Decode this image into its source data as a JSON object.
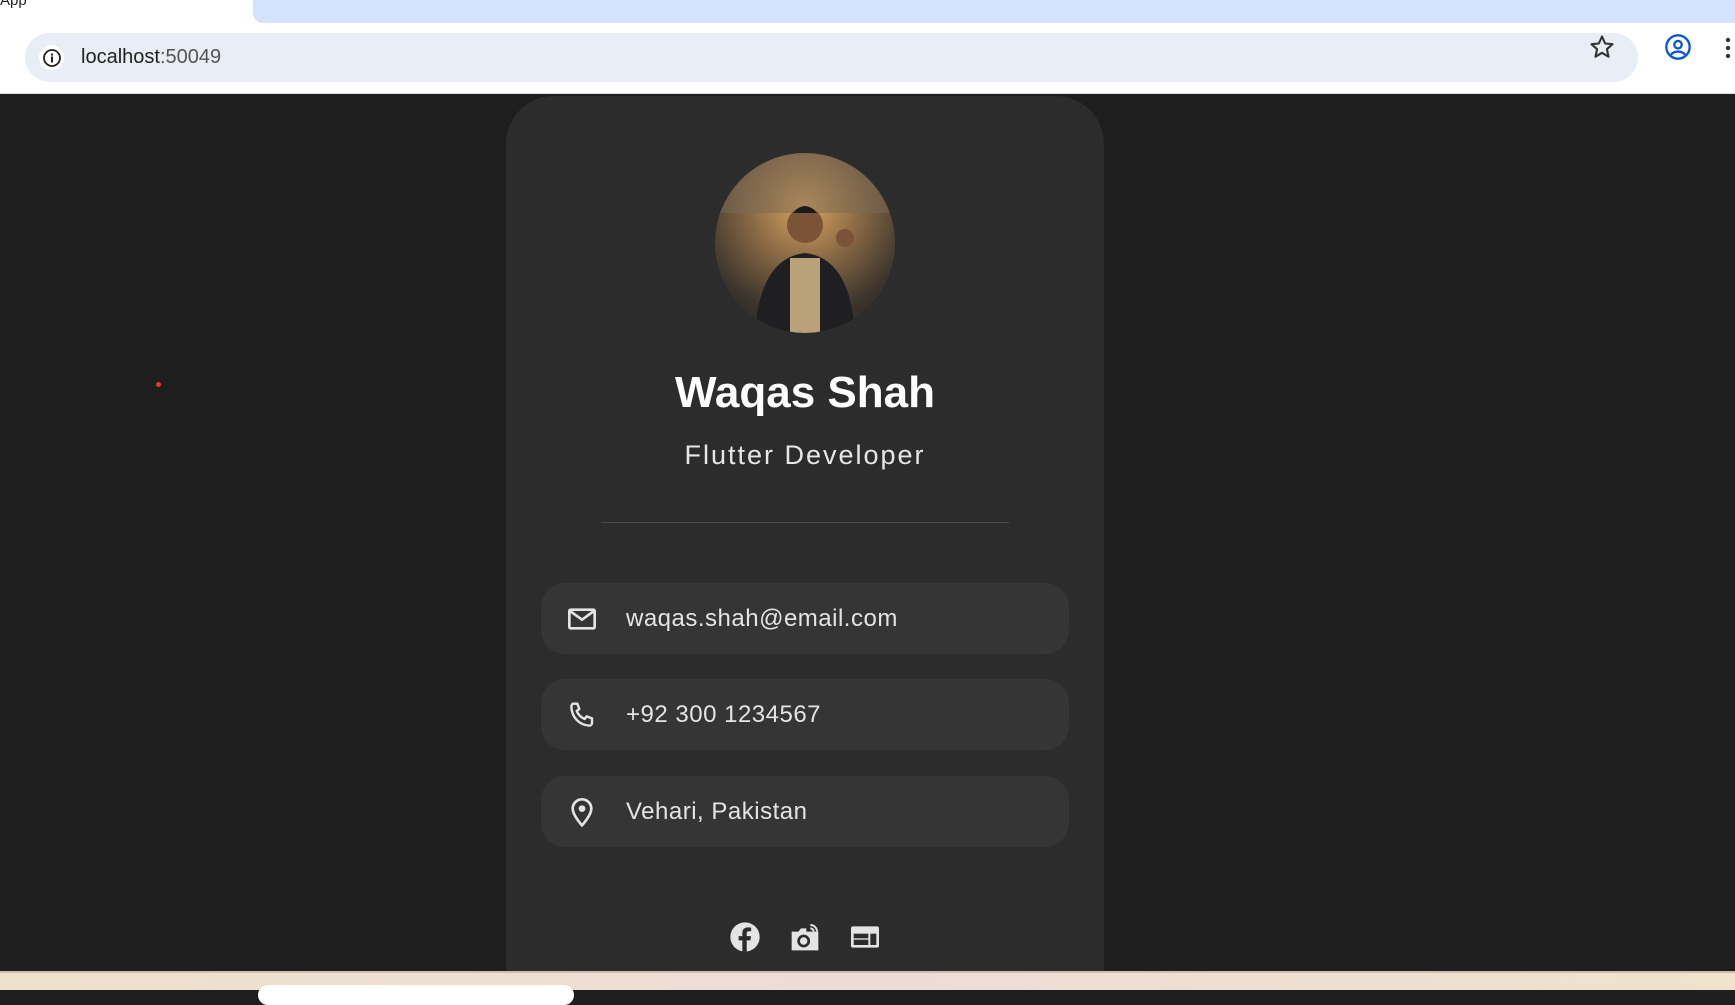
{
  "browser": {
    "tab_title": "App",
    "url_host": "localhost",
    "url_port": ":50049",
    "icons": [
      "info-icon",
      "star-icon",
      "profile-icon",
      "more-menu-icon"
    ]
  },
  "profile": {
    "name": "Waqas Shah",
    "title": "Flutter Developer",
    "contacts": [
      {
        "icon": "mail-icon",
        "text": "waqas.shah@email.com"
      },
      {
        "icon": "phone-icon",
        "text": "+92 300 1234567"
      },
      {
        "icon": "location-pin-icon",
        "text": "Vehari, Pakistan"
      }
    ],
    "social": [
      "facebook-icon",
      "camera-icon",
      "web-icon"
    ]
  },
  "colors": {
    "background": "#1e1e1e",
    "card": "#2c2c2c",
    "info_card": "#353535",
    "text": "#ffffff"
  }
}
